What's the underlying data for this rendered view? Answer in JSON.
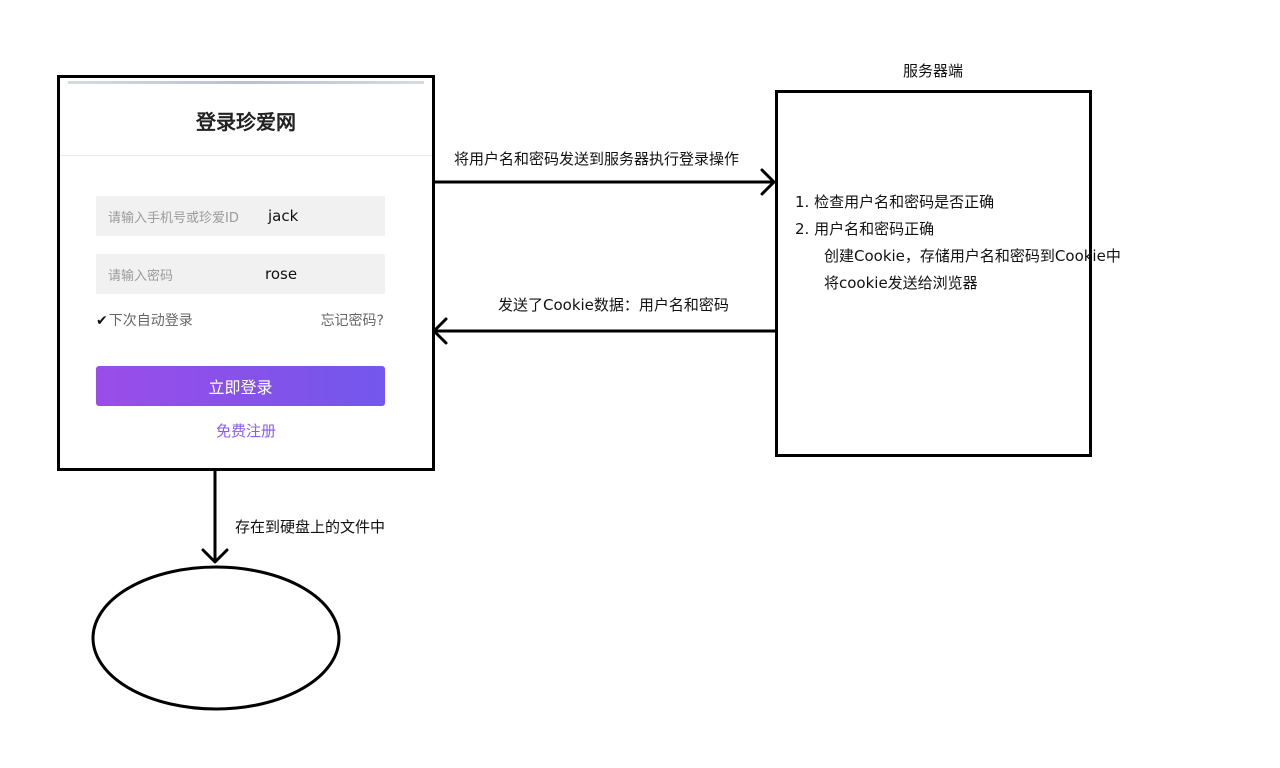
{
  "login": {
    "title": "登录珍爱网",
    "username_placeholder": "请输入手机号或珍爱ID",
    "username_value": "jack",
    "password_placeholder": "请输入密码",
    "password_value": "rose",
    "remember_check": "✔",
    "remember_label": "下次自动登录",
    "forgot_label": "忘记密码?",
    "login_button": "立即登录",
    "register_link": "免费注册"
  },
  "server": {
    "title": "服务器端",
    "lines": [
      "1. 检查用户名和密码是否正确",
      "2. 用户名和密码正确",
      "创建Cookie，存储用户名和密码到Cookie中",
      "将cookie发送给浏览器"
    ]
  },
  "arrows": {
    "to_server": "将用户名和密码发送到服务器执行登录操作",
    "to_browser": "发送了Cookie数据：用户名和密码",
    "to_disk": "存在到硬盘上的文件中"
  },
  "colors": {
    "button_start": "#9a4de8",
    "button_end": "#7357ec",
    "register_link": "#8a5cf0"
  }
}
